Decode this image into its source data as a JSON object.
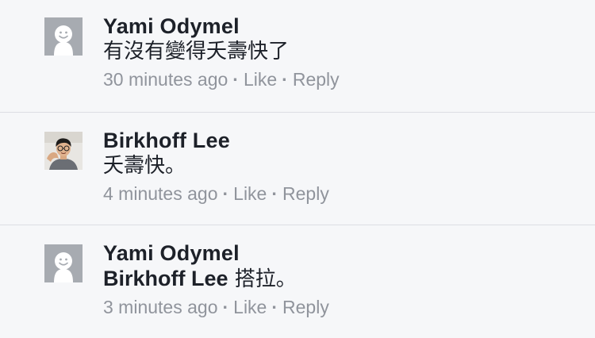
{
  "comments": [
    {
      "author": "Yami Odymel",
      "text": "有沒有變得夭壽快了",
      "tag": "",
      "time": "30 minutes ago",
      "like_label": "Like",
      "reply_label": "Reply",
      "avatar": "default-avatar-icon"
    },
    {
      "author": "Birkhoff Lee",
      "text": "夭壽快。",
      "tag": "",
      "time": "4 minutes ago",
      "like_label": "Like",
      "reply_label": "Reply",
      "avatar": "user-photo"
    },
    {
      "author": "Yami Odymel",
      "tag": "Birkhoff Lee",
      "text": " 搭拉。",
      "time": "3 minutes ago",
      "like_label": "Like",
      "reply_label": "Reply",
      "avatar": "default-avatar-icon"
    }
  ],
  "separator": "·",
  "colors": {
    "background": "#f6f7f9",
    "text": "#1d2129",
    "meta": "#90949c",
    "divider": "#dcdee3",
    "avatar_bg": "#a7abb1"
  }
}
